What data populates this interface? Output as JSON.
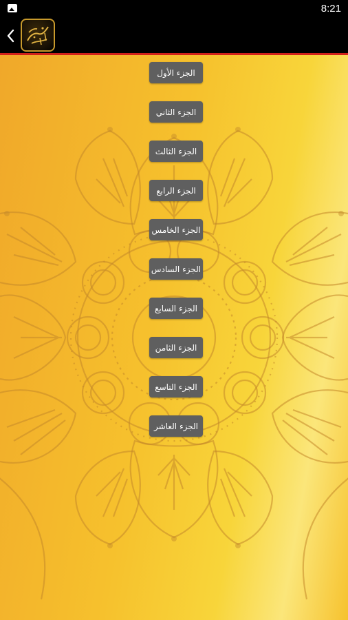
{
  "status_bar": {
    "time": "8:21",
    "notification_icon": "image-icon"
  },
  "app_bar": {
    "back_icon": "chevron-left-icon",
    "logo_icon": "calligraphy-logo-icon",
    "accent_color": "#d2211b"
  },
  "parts": [
    {
      "label": "الجزء الأول"
    },
    {
      "label": "الجزء الثاني"
    },
    {
      "label": "الجزء الثالث"
    },
    {
      "label": "الجزء الرابع"
    },
    {
      "label": "الجزء الخامس"
    },
    {
      "label": "الجزء السادس"
    },
    {
      "label": "الجزء السابع"
    },
    {
      "label": "الجزء الثامن"
    },
    {
      "label": "الجزء التاسع"
    },
    {
      "label": "الجزء العاشر"
    }
  ],
  "colors": {
    "background": "#f3b626",
    "button": "#5f5f5f",
    "button_text": "#ffffff"
  }
}
